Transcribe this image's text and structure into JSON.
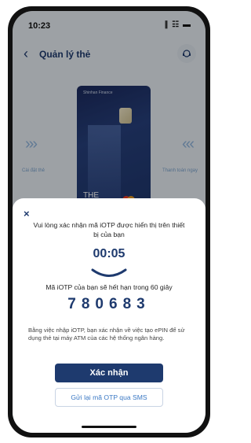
{
  "status_bar": {
    "time": "10:23",
    "icons": "∥ ☷ ▬"
  },
  "header": {
    "back_icon": "‹",
    "title": "Quản lý thẻ"
  },
  "card": {
    "brand": "Shinhan Finance",
    "text": "THE"
  },
  "carousel": {
    "left_label": "Cài đặt thẻ",
    "right_label": "Thanh toán ngay",
    "left_arrow": "›››",
    "right_arrow": "‹‹‹"
  },
  "dialog": {
    "close_icon": "×",
    "message": "Vui lòng xác nhận mã iOTP được hiển thị trên thiết bị của bạn",
    "timer": "00:05",
    "expire_text": "Mã iOTP của bạn sẽ hết hạn trong 60 giây",
    "otp_code": "780683",
    "note": "Bằng việc nhập iOTP, bạn xác nhận về việc tạo ePIN để sử dụng thẻ tại máy ATM của các hệ thống ngân hàng.",
    "confirm_label": "Xác nhận",
    "resend_label": "Gửi lại mã OTP qua SMS"
  },
  "colors": {
    "primary": "#1e3a6e",
    "link": "#3a78c4",
    "accent_arrows": "#8fb4dc"
  }
}
